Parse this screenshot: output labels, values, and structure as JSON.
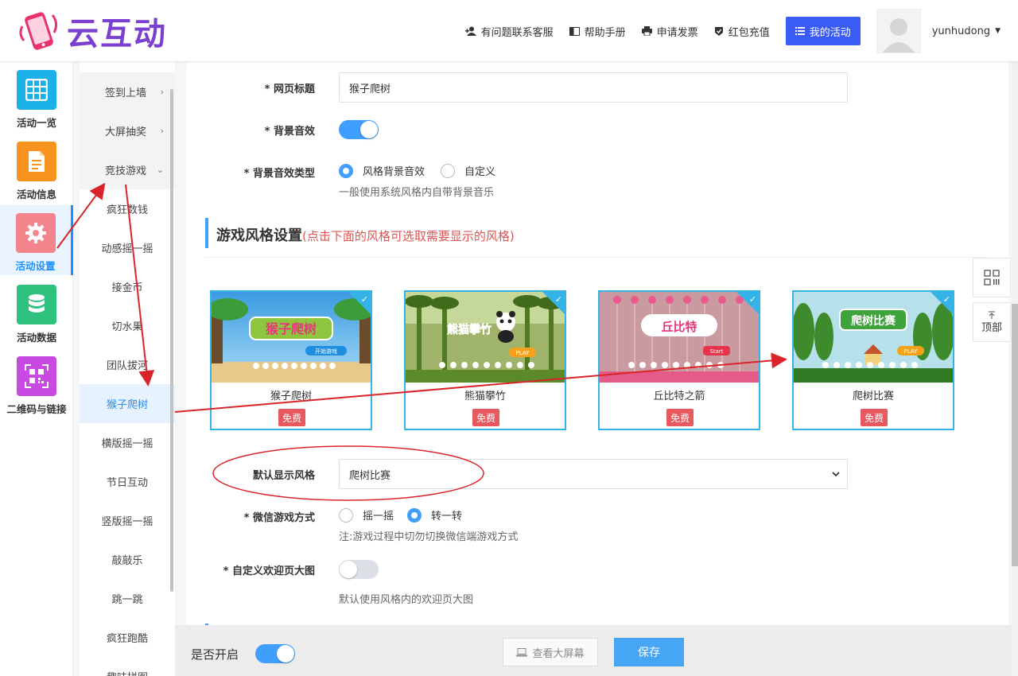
{
  "header": {
    "logo_text": "云互动",
    "nav": {
      "service": "有问题联系客服",
      "manual": "帮助手册",
      "invoice": "申请发票",
      "recharge": "红包充值",
      "my_activity": "我的活动"
    },
    "username": "yunhudong"
  },
  "left_nav": [
    {
      "label": "活动一览",
      "icon": "grid-icon",
      "color": "#1cb0e8"
    },
    {
      "label": "活动信息",
      "icon": "document-icon",
      "color": "#f7931e"
    },
    {
      "label": "活动设置",
      "icon": "gear-icon",
      "color": "#f4858f"
    },
    {
      "label": "活动数据",
      "icon": "database-icon",
      "color": "#2ec27e"
    },
    {
      "label": "二维码与链接",
      "icon": "qrcode-icon",
      "color": "#c94ae0"
    }
  ],
  "sub_nav": {
    "parents": [
      {
        "label": "签到上墙",
        "arrow": "›"
      },
      {
        "label": "大屏抽奖",
        "arrow": "›"
      },
      {
        "label": "竞技游戏",
        "arrow": "⌄"
      }
    ],
    "children": [
      "疯狂数钱",
      "动感摇一摇",
      "接金币",
      "切水果",
      "团队拔河",
      "猴子爬树",
      "横版摇一摇",
      "节日互动",
      "竖版摇一摇",
      "敲敲乐",
      "跳一跳",
      "疯狂跑酷",
      "趣味拼图"
    ]
  },
  "form": {
    "page_title_label": "* 网页标题",
    "page_title_value": "猴子爬树",
    "bg_music_label": "* 背景音效",
    "bg_music_type_label": "* 背景音效类型",
    "bg_music_options": [
      "风格背景音效",
      "自定义"
    ],
    "bg_music_hint": "一般使用系统风格内自带背景音乐",
    "section_title": "游戏风格设置",
    "section_note": "(点击下面的风格可选取需要显示的风格)",
    "styles": [
      {
        "name": "猴子爬树",
        "badge": "免费",
        "thumb_text": "猴子爬树",
        "play_text": "开始游戏"
      },
      {
        "name": "熊猫攀竹",
        "badge": "免费",
        "thumb_text": "熊猫攀竹",
        "play_text": "PLAY"
      },
      {
        "name": "丘比特之箭",
        "badge": "免费",
        "thumb_text": "丘比特",
        "play_text": "Start"
      },
      {
        "name": "爬树比赛",
        "badge": "免费",
        "thumb_text": "爬树比赛",
        "play_text": "PLAY"
      }
    ],
    "default_style_label": "默认显示风格",
    "default_style_value": "爬树比赛",
    "wechat_mode_label": "* 微信游戏方式",
    "wechat_mode_options": [
      "摇一摇",
      "转一转"
    ],
    "wechat_mode_hint": "注:游戏过程中切勿切换微信端游戏方式",
    "welcome_image_label": "* 自定义欢迎页大图",
    "welcome_image_hint": "默认使用风格内的欢迎页大图"
  },
  "bottom": {
    "enable_label": "是否开启",
    "preview_label": "查看大屏幕",
    "save_label": "保存"
  },
  "side_tools": {
    "top_label": "顶部"
  },
  "colors": {
    "accent": "#409eff",
    "nav_button": "#3b5bf5",
    "card_border": "#34b4e6",
    "badge": "#e8585f",
    "annotation": "#d9252a"
  }
}
